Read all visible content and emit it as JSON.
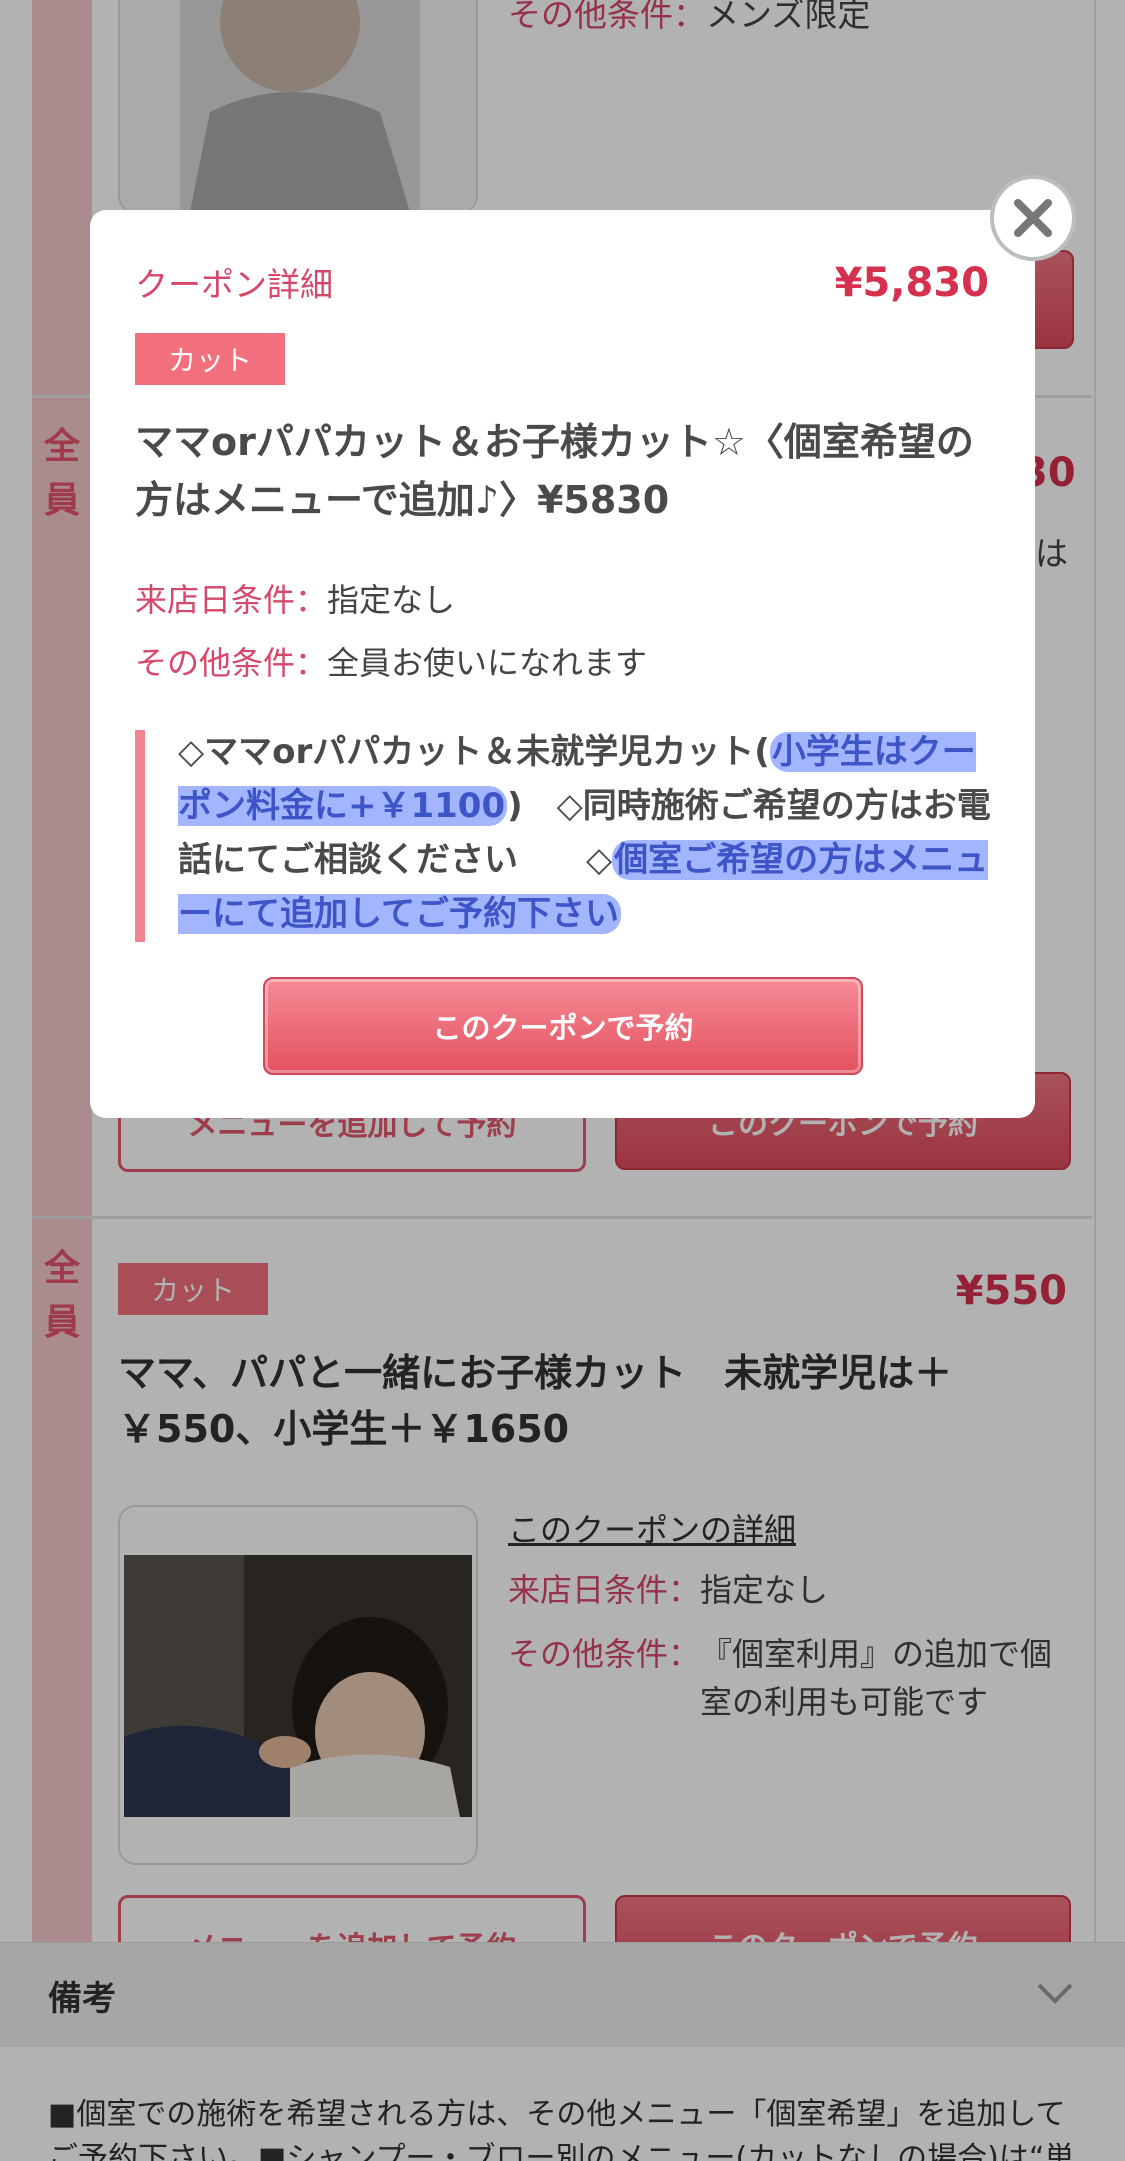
{
  "background": {
    "coupon1": {
      "other_label": "その他条件：",
      "other_value": "メンズ限定"
    },
    "coupon2": {
      "target": "全員",
      "price_fragment": "30",
      "side_fragment": "は",
      "add_menu_button": "メニューを追加して予約",
      "reserve_button": "このクーポンで予約"
    },
    "coupon3": {
      "target": "全員",
      "tag": "カット",
      "price": "¥550",
      "title": "ママ、パパと一緒にお子様カット　未就学児は＋￥550、小学生＋￥1650",
      "detail_link": "このクーポンの詳細",
      "visit_label": "来店日条件：",
      "visit_value": "指定なし",
      "other_label": "その他条件：",
      "other_value": "『個室利用』の追加で個室の利用も可能です",
      "add_menu_button": "メニューを追加して予約",
      "reserve_button": "このクーポンで予約"
    },
    "notes": {
      "title": "備考",
      "text": "■個室での施術を希望される方は、その他メニュー「個室希望」を追加してご予約下さい。■シャンプー・ブロー別のメニュー(カットなしの場合)は“単"
    }
  },
  "modal": {
    "heading": "クーポン詳細",
    "price": "¥5,830",
    "tag": "カット",
    "title": "ママorパパカット＆お子様カット☆〈個室希望の方はメニューで追加♪〉¥5830",
    "visit_label": "来店日条件：",
    "visit_value": "指定なし",
    "other_label": "その他条件：",
    "other_value": "全員お使いになれます",
    "desc_part1": "◇ママorパパカット＆未就学児カット(",
    "desc_hl1": "小学生はクーポン料金に+￥1100",
    "desc_part2": ")　◇同時施術ご希望の方はお電話にてご相談ください　　◇",
    "desc_hl2": "個室ご希望の方はメニューにて追加してご予約下さい",
    "reserve_button": "このクーポンで予約"
  },
  "colors": {
    "accent": "#d6304f",
    "tag": "#f2707d",
    "highlight": "#5a78ff"
  },
  "icons": {
    "close": "close-icon",
    "chevron": "chevron-down-icon"
  }
}
